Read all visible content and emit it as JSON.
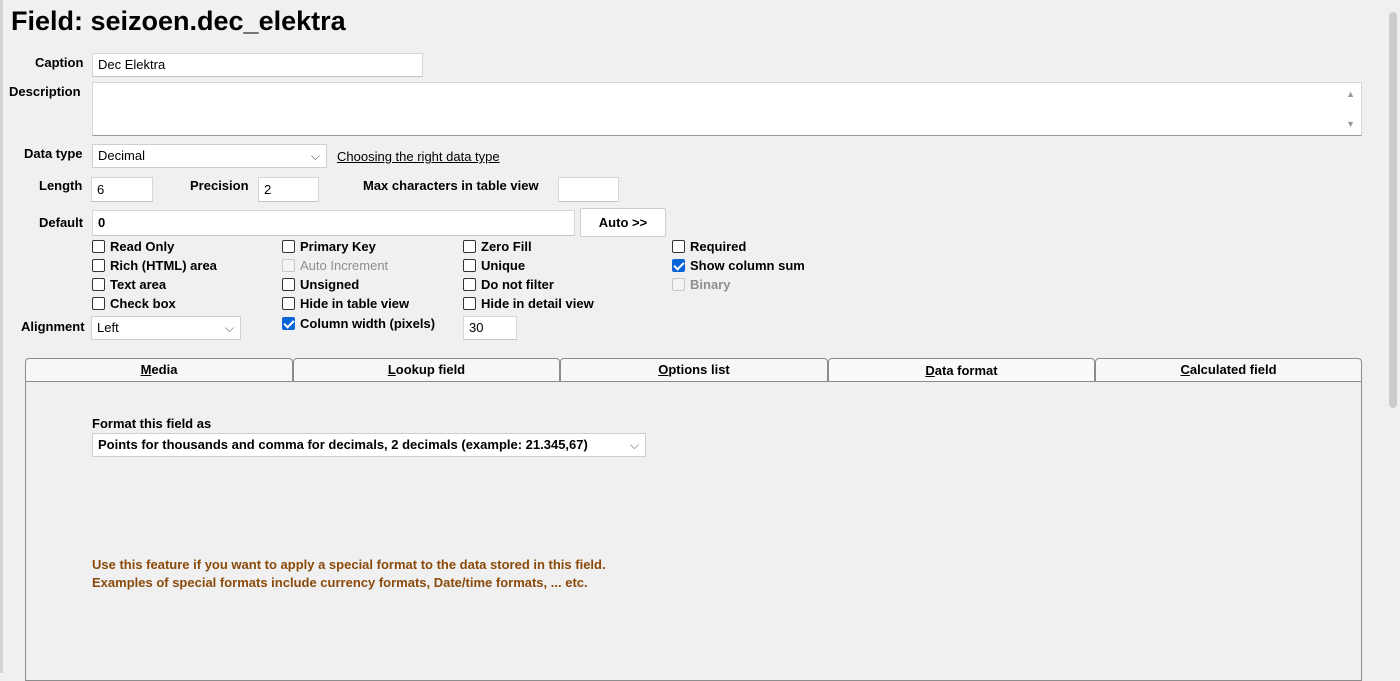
{
  "title": "Field: seizoen.dec_elektra",
  "caption": {
    "label": "Caption",
    "value": "Dec Elektra"
  },
  "description": {
    "label": "Description",
    "value": ""
  },
  "data_type": {
    "label": "Data type",
    "value": "Decimal",
    "help_link": "Choosing the right data type"
  },
  "length": {
    "label": "Length",
    "value": "6"
  },
  "precision": {
    "label": "Precision",
    "value": "2"
  },
  "max_chars": {
    "label": "Max characters in table view",
    "value": ""
  },
  "default": {
    "label": "Default",
    "value": "0",
    "auto_button": "Auto >>"
  },
  "checkboxes": {
    "read_only": {
      "label": "Read Only",
      "checked": false
    },
    "rich_html": {
      "label": "Rich (HTML) area",
      "checked": false
    },
    "text_area": {
      "label": "Text area",
      "checked": false
    },
    "check_box": {
      "label": "Check box",
      "checked": false
    },
    "primary_key": {
      "label": "Primary Key",
      "checked": false
    },
    "auto_increment": {
      "label": "Auto Increment",
      "checked": false,
      "disabled": true
    },
    "unsigned": {
      "label": "Unsigned",
      "checked": false
    },
    "hide_table": {
      "label": "Hide in table view",
      "checked": false
    },
    "column_width": {
      "label": "Column width (pixels)",
      "checked": true
    },
    "zero_fill": {
      "label": "Zero Fill",
      "checked": false
    },
    "unique": {
      "label": "Unique",
      "checked": false
    },
    "do_not_filter": {
      "label": "Do not filter",
      "checked": false
    },
    "hide_detail": {
      "label": "Hide in detail view",
      "checked": false
    },
    "required": {
      "label": "Required",
      "checked": false
    },
    "show_sum": {
      "label": "Show column sum",
      "checked": true
    },
    "binary": {
      "label": "Binary",
      "checked": false,
      "disabled": true
    }
  },
  "column_width_value": "30",
  "alignment": {
    "label": "Alignment",
    "value": "Left"
  },
  "tabs": {
    "media": {
      "first": "M",
      "rest": "edia"
    },
    "lookup": {
      "first": "L",
      "rest": "ookup field"
    },
    "options": {
      "first": "O",
      "rest": "ptions list"
    },
    "data_format": {
      "first": "D",
      "rest": "ata format"
    },
    "calculated": {
      "first": "C",
      "rest": "alculated field"
    }
  },
  "active_tab_underline_color": "#f5a623",
  "data_format_panel": {
    "format_label": "Format this field as",
    "format_value": "Points for thousands and comma for decimals, 2 decimals (example: 21.345,67)",
    "hint_line1": "Use this feature if you want to apply a special format to the data stored in this field.",
    "hint_line2": "Examples of special formats include currency formats, Date/time formats, ... etc.",
    "hint_color": "#8a4a0a"
  }
}
